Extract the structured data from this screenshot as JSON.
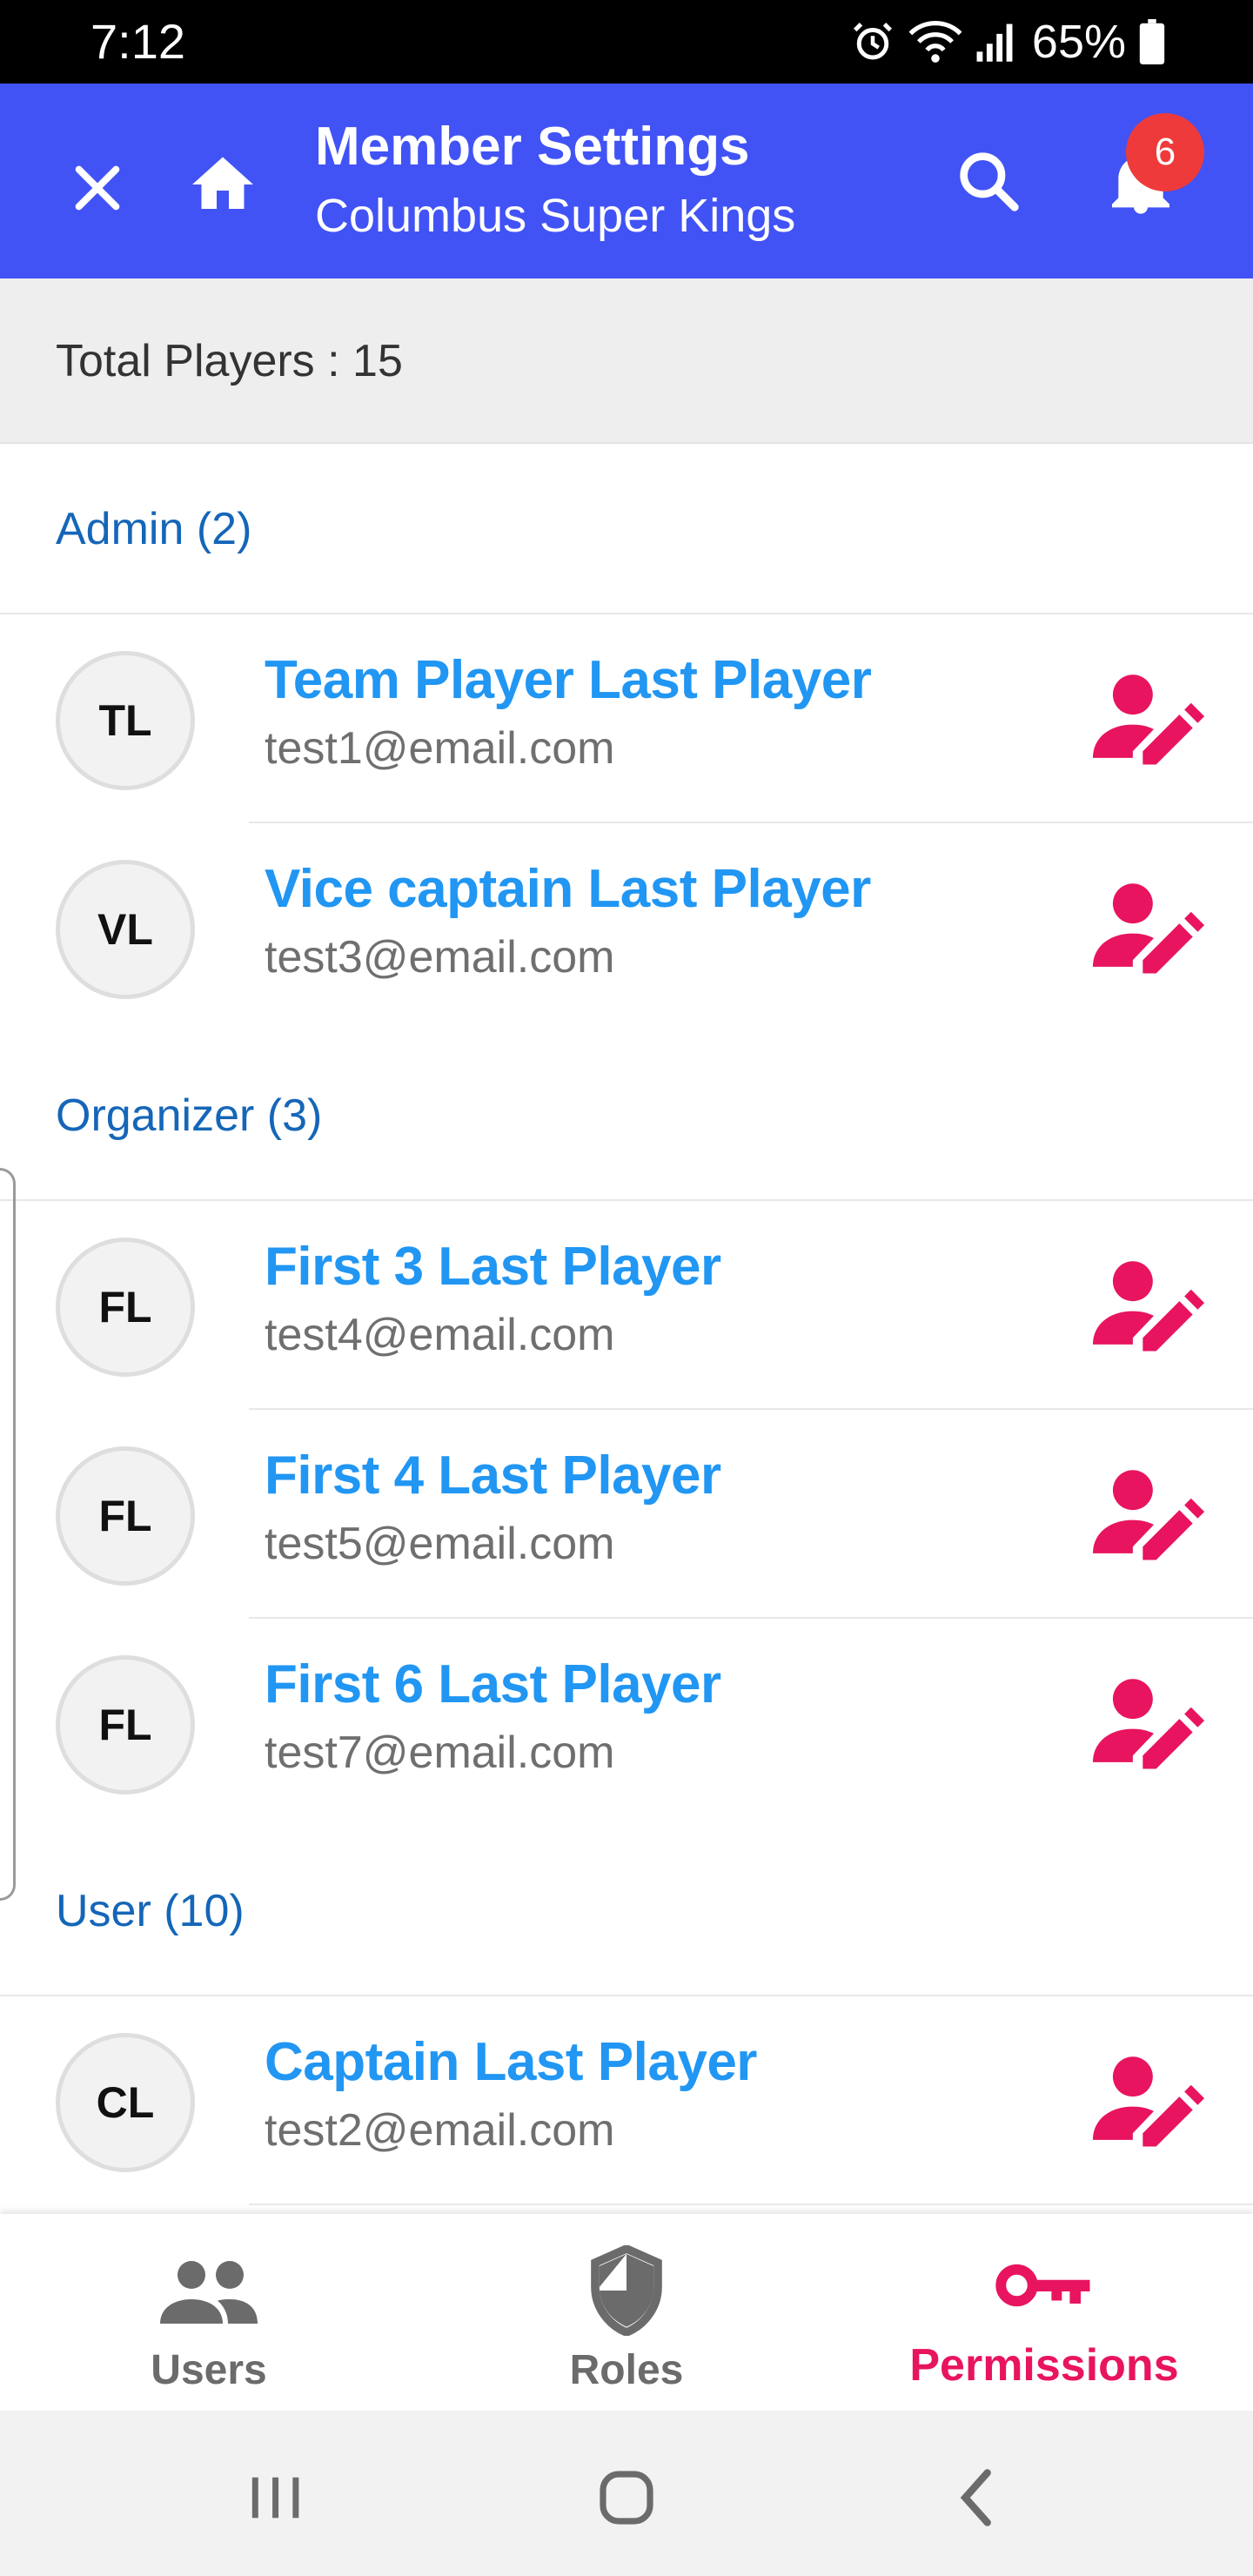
{
  "status_bar": {
    "time": "7:12",
    "battery": "65%",
    "icons": [
      "alarm-icon",
      "wifi-icon",
      "signal-icon",
      "battery-icon"
    ]
  },
  "app_bar": {
    "title": "Member Settings",
    "subtitle": "Columbus Super Kings",
    "notification_count": "6",
    "icons": [
      "close-icon",
      "home-icon",
      "search-icon",
      "bell-icon"
    ],
    "background": "#4153f5"
  },
  "summary": {
    "total_players": "Total Players : 15"
  },
  "sections": [
    {
      "label": "Admin (2)",
      "members": [
        {
          "initials": "TL",
          "name": "Team Player Last Player",
          "email": "test1@email.com"
        },
        {
          "initials": "VL",
          "name": "Vice captain Last Player",
          "email": "test3@email.com"
        }
      ]
    },
    {
      "label": "Organizer (3)",
      "members": [
        {
          "initials": "FL",
          "name": "First 3 Last Player",
          "email": "test4@email.com"
        },
        {
          "initials": "FL",
          "name": "First 4 Last Player",
          "email": "test5@email.com"
        },
        {
          "initials": "FL",
          "name": "First 6 Last Player",
          "email": "test7@email.com"
        }
      ]
    },
    {
      "label": "User (10)",
      "members": [
        {
          "initials": "CL",
          "name": "Captain Last Player",
          "email": "test2@email.com"
        }
      ]
    }
  ],
  "row_action_icon": "user-edit-icon",
  "bottom_nav": {
    "tabs": [
      {
        "label": "Users",
        "icon": "people-icon",
        "active": false
      },
      {
        "label": "Roles",
        "icon": "shield-icon",
        "active": false
      },
      {
        "label": "Permissions",
        "icon": "key-icon",
        "active": true
      }
    ],
    "active_color": "#e8145f"
  },
  "system_nav": {
    "icons": [
      "recent-apps-icon",
      "home-button-icon",
      "back-icon"
    ]
  }
}
